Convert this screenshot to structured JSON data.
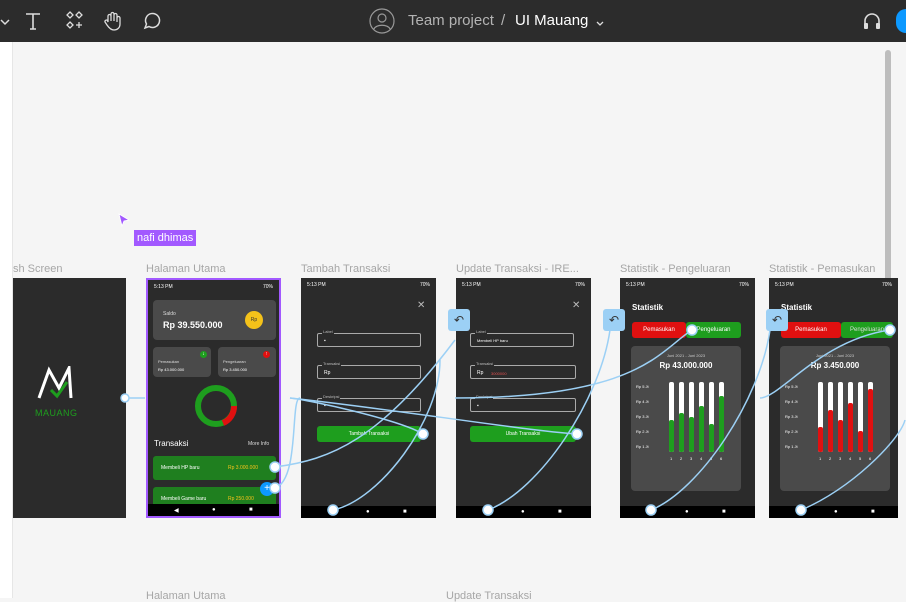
{
  "topbar": {
    "team": "Team project",
    "separator": "/",
    "file": "UI Mauang"
  },
  "canvas": {
    "cursor_user": "nafi dhimas",
    "frames": [
      {
        "label": "sh Screen"
      },
      {
        "label": "Halaman Utama"
      },
      {
        "label": "Tambah Transaksi"
      },
      {
        "label": "Update Transaksi - IRE..."
      },
      {
        "label": "Statistik -  Pengeluaran"
      },
      {
        "label": "Statistik -  Pemasukan"
      }
    ],
    "bottom_labels": [
      "Halaman Utama",
      "Update Transaksi"
    ]
  },
  "phone": {
    "time": "5:13 PM",
    "battery": "70%"
  },
  "splash": {
    "brand": "MAUANG"
  },
  "home": {
    "saldo_label": "Saldo",
    "saldo_value": "Rp 39.550.000",
    "pemasukan_label": "Pemasukan",
    "pemasukan_value": "Rp 43.000.000",
    "pengeluaran_label": "Pengeluaran",
    "pengeluaran_value": "Rp 3.450.000",
    "transaksi_title": "Transaksi",
    "more_info": "More Info",
    "items": [
      {
        "name": "Membeli HP baru",
        "amount": "Rp 3.000.000"
      },
      {
        "name": "Membeli Game baru",
        "amount": "Rp 250.000"
      }
    ]
  },
  "tambah": {
    "label_field": "Label",
    "transaksi_field": "Transaksi",
    "transaksi_value": "Rp",
    "deskripsi_field": "Deskripsi",
    "button": "Tambah Transaksi"
  },
  "update": {
    "label_field": "Label",
    "label_value": "Membeli HP baru",
    "transaksi_field": "Transaksi",
    "transaksi_value": "Rp",
    "transaksi_amount": "3000000",
    "deskripsi_field": "Deskripsi",
    "button": "Ubah Transaksi"
  },
  "stat_out": {
    "title": "Statistik",
    "tab_in": "Pemasukan",
    "tab_out": "Pengeluaran",
    "period": "Juni 2021 - Juni 2023",
    "total": "Rp  43.000.000",
    "ylabels": [
      "Rp 5 Jt",
      "Rp 4 Jt",
      "Rp 3 Jt",
      "Rp 2 Jt",
      "Rp 1 Jt"
    ],
    "xlabels": [
      "1",
      "2",
      "3",
      "4",
      "5",
      "6"
    ],
    "fills": [
      0.45,
      0.55,
      0.5,
      0.65,
      0.4,
      0.8
    ]
  },
  "stat_in": {
    "title": "Statistik",
    "tab_in": "Pemasukan",
    "tab_out": "Pengeluaran",
    "period": "Juni 2021 - Juni 2023",
    "total": "Rp 3.450.000",
    "ylabels": [
      "Rp 5 Jt",
      "Rp 4 Jt",
      "Rp 3 Jt",
      "Rp 2 Jt",
      "Rp 1 Jt"
    ],
    "xlabels": [
      "1",
      "2",
      "3",
      "4",
      "5",
      "6"
    ],
    "fills": [
      0.35,
      0.6,
      0.45,
      0.7,
      0.3,
      0.9
    ]
  },
  "colors": {
    "accent_green": "#1e9e1e",
    "accent_red": "#e01010",
    "selection": "#a259ff",
    "link": "#9cd0f5"
  }
}
